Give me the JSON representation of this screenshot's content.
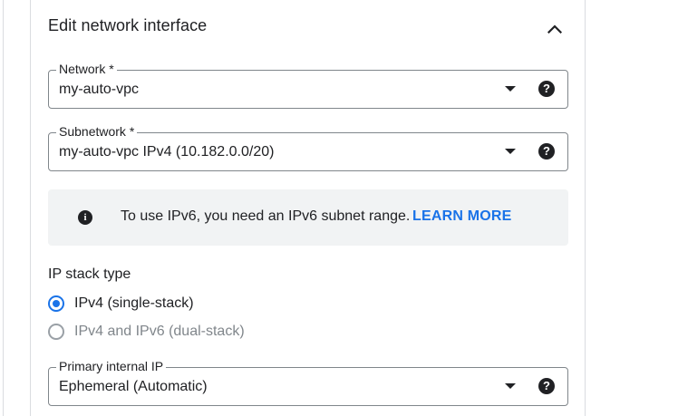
{
  "section": {
    "title": "Edit network interface",
    "collapse_icon": "chevron-up-icon"
  },
  "network": {
    "label": "Network *",
    "value": "my-auto-vpc"
  },
  "subnetwork": {
    "label": "Subnetwork *",
    "value": "my-auto-vpc IPv4 (10.182.0.0/20)"
  },
  "info": {
    "icon": "info-icon",
    "text": "To use IPv6, you need an IPv6 subnet range.",
    "link": "LEARN MORE"
  },
  "ip_stack": {
    "label": "IP stack type",
    "options": [
      {
        "label": "IPv4 (single-stack)",
        "selected": true
      },
      {
        "label": "IPv4 and IPv6 (dual-stack)",
        "selected": false
      }
    ]
  },
  "primary_ip": {
    "label": "Primary internal IP",
    "value": "Ephemeral (Automatic)"
  },
  "help_glyph": "?",
  "info_glyph": "i",
  "colors": {
    "accent": "#1a73e8",
    "text": "#202124",
    "border": "#80868b",
    "info_bg": "#f1f3f4"
  }
}
